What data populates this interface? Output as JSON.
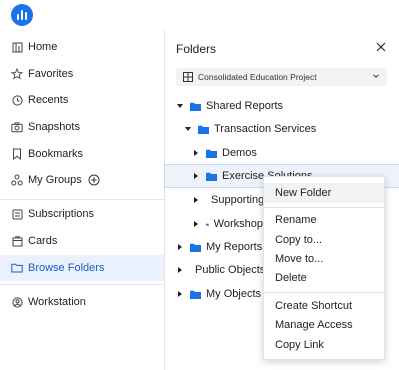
{
  "nav": {
    "items": [
      {
        "label": "Home",
        "icon": "home-icon"
      },
      {
        "label": "Favorites",
        "icon": "star-icon"
      },
      {
        "label": "Recents",
        "icon": "clock-icon"
      },
      {
        "label": "Snapshots",
        "icon": "camera-icon"
      },
      {
        "label": "Bookmarks",
        "icon": "bookmark-icon"
      },
      {
        "label": "My Groups",
        "icon": "groups-icon"
      },
      {
        "label": "Subscriptions",
        "icon": "subscriptions-icon"
      },
      {
        "label": "Cards",
        "icon": "cards-icon"
      },
      {
        "label": "Browse Folders",
        "icon": "folder-icon",
        "active": true
      },
      {
        "label": "Workstation",
        "icon": "workstation-icon"
      }
    ]
  },
  "panel": {
    "title": "Folders",
    "project": "Consolidated Education Project"
  },
  "tree": [
    {
      "label": "Shared Reports",
      "expanded": true
    },
    {
      "label": "Transaction Services",
      "expanded": true
    },
    {
      "label": "Demos",
      "expanded": false
    },
    {
      "label": "Exercise Solutions",
      "expanded": false,
      "selected": true
    },
    {
      "label": "Supporting",
      "expanded": false
    },
    {
      "label": "Workshop",
      "expanded": false
    },
    {
      "label": "My Reports",
      "expanded": false
    },
    {
      "label": "Public Objects",
      "expanded": false
    },
    {
      "label": "My Objects",
      "expanded": false
    }
  ],
  "context_menu": {
    "items": [
      "New Folder",
      "Rename",
      "Copy to...",
      "Move to...",
      "Delete",
      "Create Shortcut",
      "Manage Access",
      "Copy Link"
    ],
    "hovered": "New Folder"
  },
  "colors": {
    "accent": "#1a73e8",
    "active_bg": "#eaf1fd",
    "folder": "#1a73e8"
  }
}
